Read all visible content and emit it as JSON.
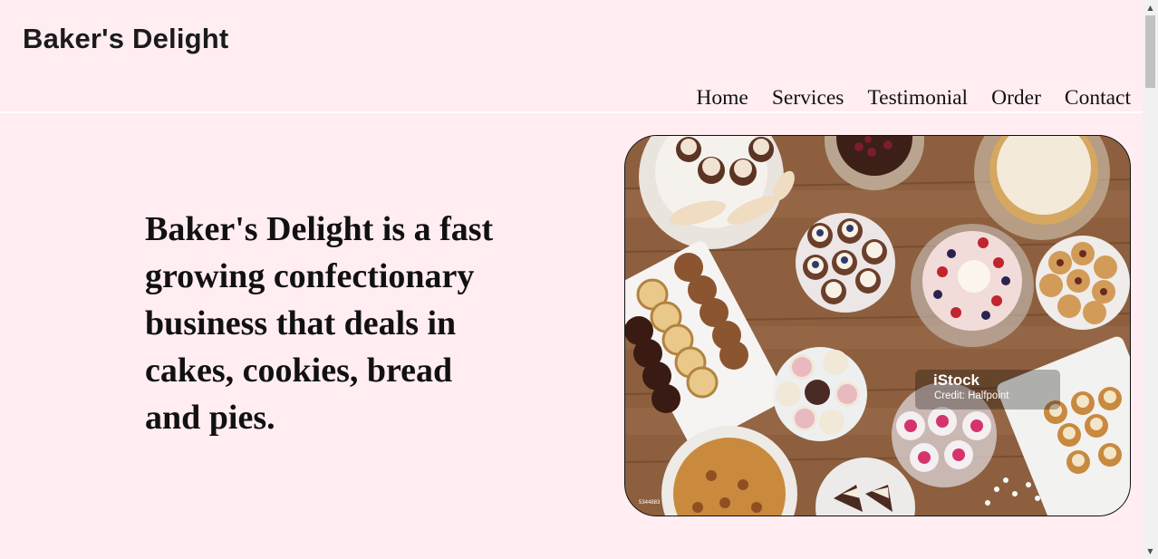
{
  "brand": "Baker's Delight",
  "nav": [
    "Home",
    "Services",
    "Testimonial",
    "Order",
    "Contact"
  ],
  "hero": {
    "headline": "Baker's Delight is a fast growing confectionary business that deals in cakes, cookies, bread and pies.",
    "image": {
      "watermark_logo": "iStock",
      "watermark_credit": "Credit: Halfpoint",
      "watermark_id": "5344883"
    }
  },
  "colors": {
    "background": "#ffedf1",
    "text": "#111111",
    "table_wood": "#8a5c3c"
  },
  "icons": [
    "scroll-up-arrow-icon",
    "scroll-down-arrow-icon"
  ]
}
